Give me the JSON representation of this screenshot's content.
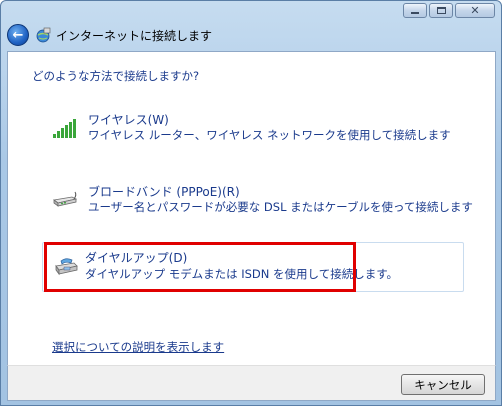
{
  "window": {
    "title": "インターネットに接続します",
    "caption_buttons": [
      "minimize-icon",
      "maximize-icon",
      "close-icon"
    ]
  },
  "question": "どのような方法で接続しますか?",
  "options": [
    {
      "title": "ワイヤレス(W)",
      "description": "ワイヤレス ルーター、ワイヤレス ネットワークを使用して接続します",
      "icon": "wireless-signal-icon"
    },
    {
      "title": "ブロードバンド (PPPoE)(R)",
      "description": "ユーザー名とパスワードが必要な DSL またはケーブルを使って接続します",
      "icon": "broadband-modem-icon"
    },
    {
      "title": "ダイヤルアップ(D)",
      "description": "ダイヤルアップ モデムまたは ISDN を使用して接続します。",
      "icon": "dialup-phone-icon",
      "highlighted": true,
      "highlight_color": "#e00000"
    }
  ],
  "help_link": "選択についての説明を表示します",
  "footer": {
    "cancel_label": "キャンセル"
  },
  "colors": {
    "link_text": "#1a3a8c",
    "highlight": "#e00000"
  }
}
